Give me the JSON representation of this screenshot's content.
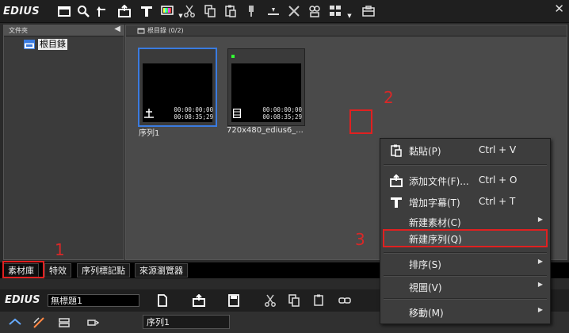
{
  "app": {
    "logo": "EDIUS",
    "close": "✕"
  },
  "toolbar": {
    "icons": [
      "folder-icon",
      "search-icon",
      "up-folder-icon",
      "add-file-icon",
      "title-icon",
      "color-bars-icon",
      "cut-icon",
      "copy-icon",
      "paste-icon",
      "pin-icon",
      "timeline-icon",
      "delete-icon",
      "properties-icon",
      "view-icon",
      "settings-icon"
    ]
  },
  "folder_panel": {
    "title": "文件夾",
    "collapse": "◀",
    "root_label": "根目錄"
  },
  "bin": {
    "title": "根目錄 (0/2)",
    "clips": [
      {
        "name": "序列1",
        "tc_in": "00:00:00;00",
        "tc_out": "00:08:35;29",
        "icon": "sequence-icon",
        "selected": true
      },
      {
        "name": "720x480_edius6_...",
        "tc_in": "00:00:00;00",
        "tc_out": "00:08:35;29",
        "icon": "clip-icon",
        "selected": false
      }
    ]
  },
  "tabs": [
    "素材庫",
    "特效",
    "序列標記點",
    "來源瀏覽器"
  ],
  "bottom": {
    "logo": "EDIUS",
    "project_name": "無標題1",
    "sequence_tab": "序列1"
  },
  "context_menu": {
    "items": [
      {
        "label": "黏貼(P)",
        "shortcut": "Ctrl + V",
        "icon": "paste-icon"
      },
      {
        "label": "添加文件(F)...",
        "shortcut": "Ctrl + O",
        "icon": "add-file-icon"
      },
      {
        "label": "增加字幕(T)",
        "shortcut": "Ctrl + T",
        "icon": "title-icon"
      },
      {
        "label": "新建素材(C)",
        "shortcut": "",
        "submenu": true
      },
      {
        "label": "新建序列(Q)",
        "shortcut": "",
        "highlighted": true
      },
      {
        "label": "排序(S)",
        "shortcut": "",
        "submenu": true
      },
      {
        "label": "視圖(V)",
        "shortcut": "",
        "submenu": true
      },
      {
        "label": "移動(M)",
        "shortcut": "",
        "submenu": true
      }
    ]
  },
  "annotations": {
    "one": "1",
    "two": "2",
    "three": "3"
  },
  "colors": {
    "annotation_red": "#e02020",
    "selection_blue": "#3a7be0"
  }
}
